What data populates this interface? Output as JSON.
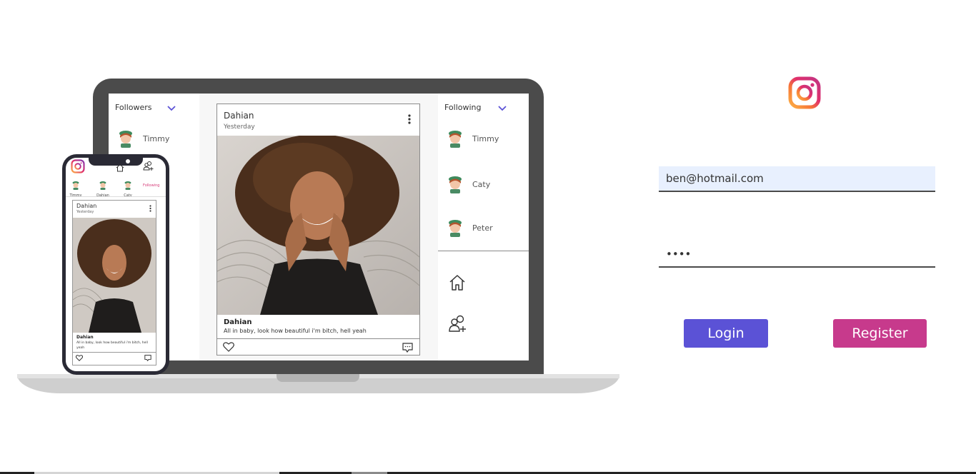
{
  "mockup": {
    "laptop": {
      "followers_title": "Followers",
      "following_title": "Following",
      "followers": [
        {
          "name": "Timmy"
        }
      ],
      "following": [
        {
          "name": "Timmy"
        },
        {
          "name": "Caty"
        },
        {
          "name": "Peter"
        }
      ],
      "post": {
        "author": "Dahian",
        "time": "Yesterday",
        "caption_author": "Dahian",
        "caption": "All in baby, look how beautiful i'm bitch, hell yeah"
      },
      "nav_icons": [
        "home-icon",
        "add-user-icon"
      ]
    },
    "phone": {
      "stories": [
        {
          "name": "Timmy"
        },
        {
          "name": "Dahian"
        },
        {
          "name": "Caty"
        }
      ],
      "following_label": "Following",
      "post": {
        "author": "Dahian",
        "time": "Yesterday",
        "caption_author": "Dahian",
        "caption": "All in baby, look how beautiful i'm bitch, hell yeah"
      }
    }
  },
  "login": {
    "logo_icon": "instagram-icon",
    "email_value": "ben@hotmail.com",
    "password_value": "••••",
    "login_label": "Login",
    "register_label": "Register"
  },
  "colors": {
    "login_button": "#5b52d6",
    "register_button": "#c73a8c",
    "email_field_bg": "#e8f0fe",
    "accent_chevron": "#5b52d6"
  }
}
